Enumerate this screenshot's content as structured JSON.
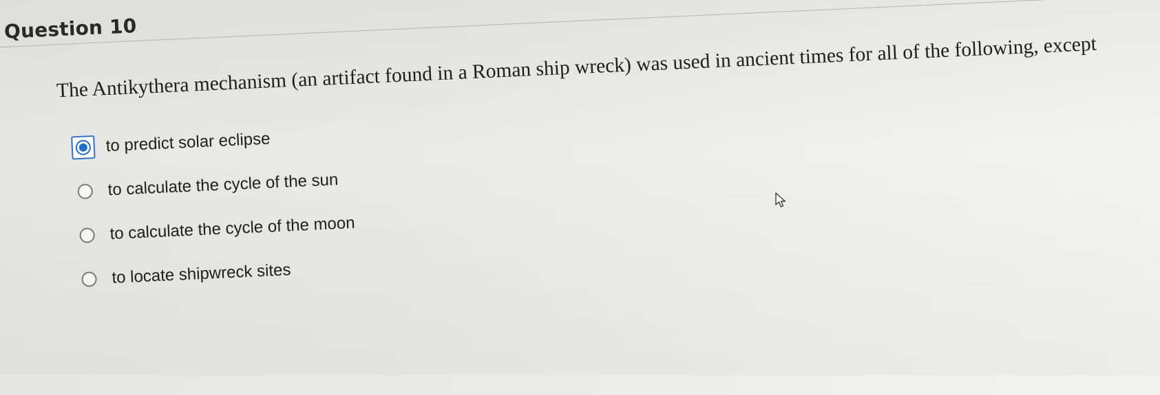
{
  "question": {
    "title": "Question 10",
    "text": "The Antikythera mechanism (an artifact found in a Roman ship wreck) was used in ancient times for all of the following, except",
    "options": [
      {
        "label": "to predict solar eclipse",
        "selected": true
      },
      {
        "label": "to calculate the cycle of the sun",
        "selected": false
      },
      {
        "label": "to calculate the cycle of the moon",
        "selected": false
      },
      {
        "label": "to locate shipwreck sites",
        "selected": false
      }
    ]
  },
  "colors": {
    "accent": "#1f6fd0",
    "background": "#ebebe9",
    "text": "#1f1f1f"
  },
  "cursor": {
    "icon": "mouse-pointer-icon"
  }
}
